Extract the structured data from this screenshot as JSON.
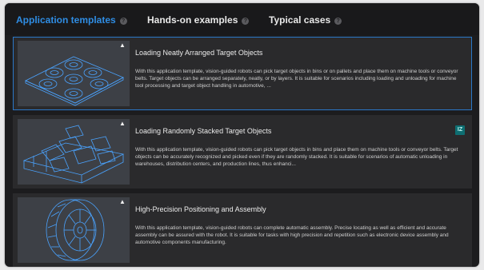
{
  "tabs": [
    {
      "label": "Application templates",
      "active": true
    },
    {
      "label": "Hands-on examples",
      "active": false
    },
    {
      "label": "Typical cases",
      "active": false
    }
  ],
  "help_glyph": "?",
  "cloud_glyph": "▲",
  "cards": [
    {
      "title": "Loading Neatly Arranged Target Objects",
      "description": "With this application template, vision-guided robots can pick target objects in bins or on pallets and place them on machine tools or conveyor belts. Target objects can be arranged separately, neatly, or by layers. It is suitable for scenarios including loading and unloading for machine tool processing and target object handling in automotive, ...",
      "icon": "cloud-download-icon",
      "selected": true
    },
    {
      "title": "Loading Randomly Stacked Target Objects",
      "description": "With this application template, vision-guided robots can pick target objects in bins and place them on machine tools or conveyor belts. Target objects can be accurately recognized and picked even if they are randomly stacked. It is suitable for scenarios of automatic unloading in warehouses, distribution centers, and production lines, thus enhanci...",
      "icon": "cloud-download-icon",
      "badge": "IZ",
      "selected": false
    },
    {
      "title": "High-Precision Positioning and Assembly",
      "description": "With this application template, vision-guided robots can complete automatic assembly. Precise locating as well as efficient and accurate assembly can be assured with the robot. It is suitable for tasks with high precision and repetition such as electronic device assembly and automotive components manufacturing.",
      "icon": "cloud-download-icon",
      "selected": false
    }
  ],
  "colors": {
    "accent": "#2f8de4",
    "selected_border": "#2a78c8",
    "card_bg": "#2a2a2c",
    "thumb_bg": "#3d4046",
    "wireframe": "#4aa3ff"
  }
}
